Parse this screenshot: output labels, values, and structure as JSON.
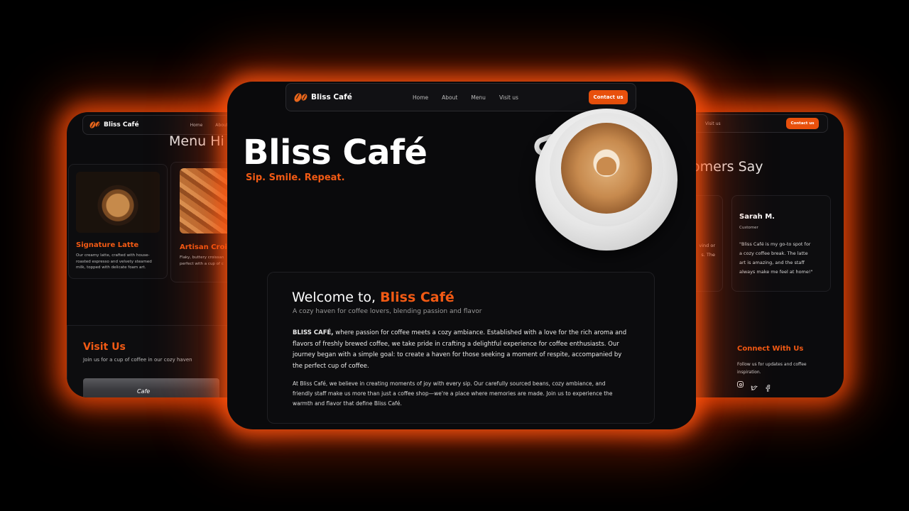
{
  "brand": "Bliss Café",
  "colors": {
    "accent": "#e8500c",
    "accent_text": "#f25a14",
    "bg": "#0a0a0c",
    "glow": "#ff5a14"
  },
  "left_panel": {
    "nav": {
      "brand": "Bliss Café",
      "links": [
        "Home",
        "About"
      ]
    },
    "section_title": "Menu Hi",
    "items": [
      {
        "title": "Signature Latte",
        "desc_lines": [
          "Our creamy latte, crafted with house-",
          "roasted espresso and velvety steamed",
          "milk, topped with delicate foam art."
        ]
      },
      {
        "title": "Artisan Crois",
        "desc_lines": [
          "Flaky, buttery croissan",
          "perfect with a cup of c"
        ]
      }
    ],
    "visit": {
      "title": "Visit Us",
      "subtitle": "Join us for a cup of coffee in our cozy haven",
      "building_sign": "Cafe"
    }
  },
  "center_panel": {
    "nav": {
      "brand": "Bliss Café",
      "links": [
        "Home",
        "About",
        "Menu",
        "Visit us"
      ],
      "cta": "Contact us"
    },
    "hero_title": "Bliss Café",
    "hero_tagline": "Sip. Smile. Repeat.",
    "welcome": {
      "heading_prefix": "Welcome to,",
      "heading_brand": "Bliss Café",
      "subheading": "A cozy haven for coffee lovers, blending passion and flavor",
      "para1_bold": "BLISS CAFÉ,",
      "para1_lines": [
        " where passion for coffee meets a cozy ambiance. Established with a love for the rich aroma and",
        "flavors of freshly brewed coffee, we take pride in crafting a delightful experience for coffee enthusiasts. Our",
        "journey began with a simple goal: to create a haven for those seeking a moment of respite, accompanied by",
        "the perfect cup of coffee."
      ],
      "para2_lines": [
        "At Bliss Café, we believe in creating moments of joy with every sip. Our carefully sourced beans, cozy ambiance, and",
        "friendly staff make us more than just a coffee shop—we're a place where memories are made. Join us to experience the",
        "warmth and flavor that define Bliss Café."
      ]
    }
  },
  "right_panel": {
    "nav": {
      "links": [
        "Visit us"
      ],
      "cta": "Contact us"
    },
    "section_title": "omers Say",
    "partial_card_fragments": [
      "vind  or",
      "s.  The",
      "\""
    ],
    "testimonial": {
      "name": "Sarah M.",
      "role": "Customer",
      "quote_lines": [
        "\"Bliss Café is my go-to spot for",
        "a cozy coffee break. The latte",
        "art is amazing, and the staff",
        "always make me feel at home!\""
      ]
    },
    "connect": {
      "title": "Connect With Us",
      "text_lines": [
        "Follow us for updates and coffee",
        "inspiration."
      ],
      "icons": [
        "instagram-icon",
        "twitter-icon",
        "facebook-icon"
      ]
    }
  }
}
